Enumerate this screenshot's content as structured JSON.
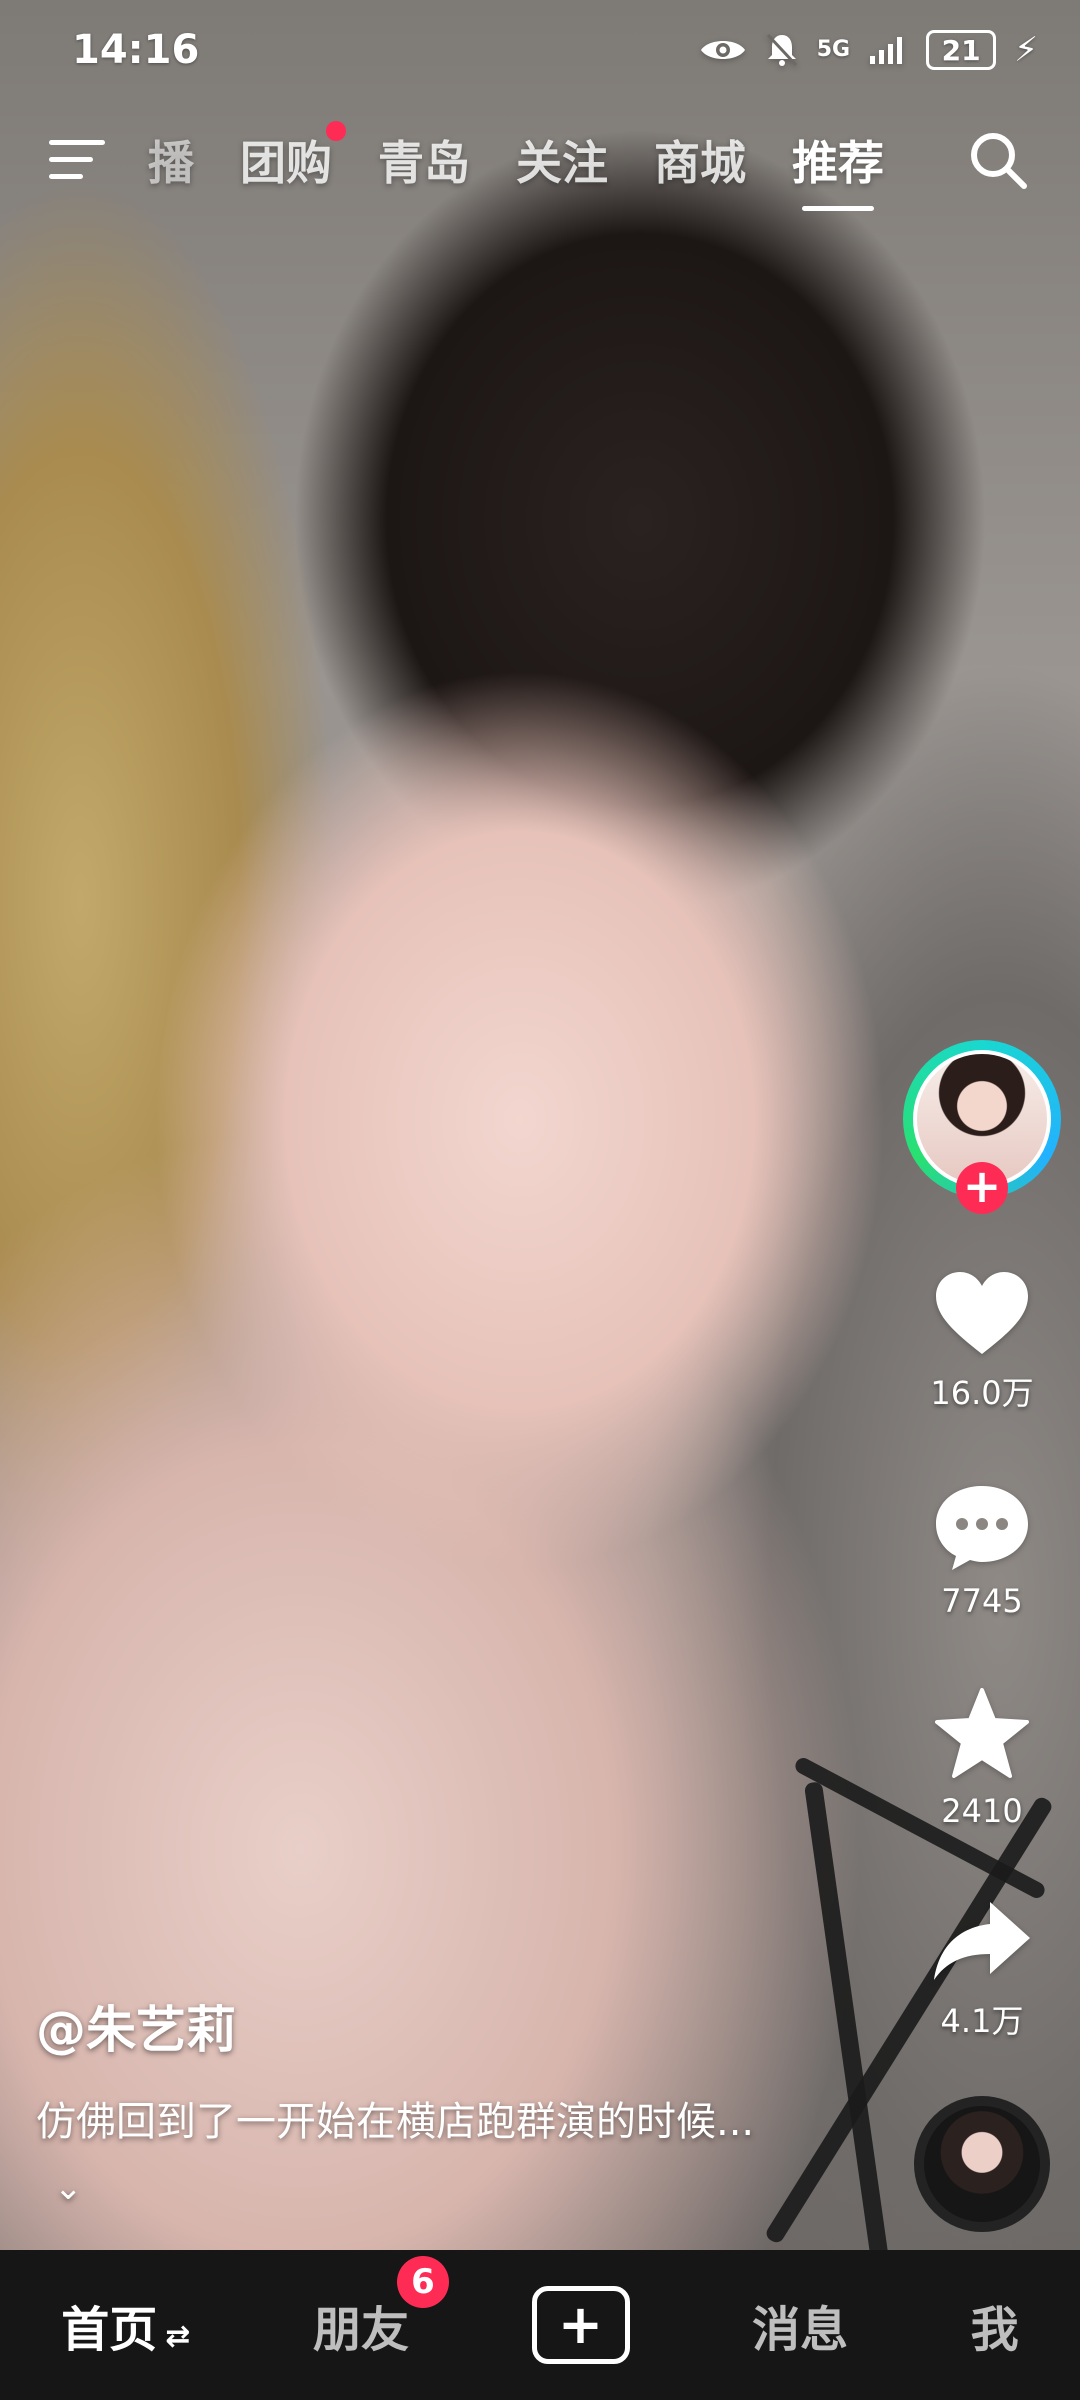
{
  "status_bar": {
    "time": "14:16",
    "network": "5G",
    "battery": "21",
    "icons": [
      "eye-icon",
      "bell-off-icon",
      "signal-icon",
      "battery-icon",
      "charging-icon"
    ]
  },
  "top_nav": {
    "tabs": [
      {
        "label": "播",
        "active": false
      },
      {
        "label": "团购",
        "active": false,
        "dot": true
      },
      {
        "label": "青岛",
        "active": false
      },
      {
        "label": "关注",
        "active": false
      },
      {
        "label": "商城",
        "active": false
      },
      {
        "label": "推荐",
        "active": true
      }
    ]
  },
  "actions": {
    "like_count": "16.0万",
    "comment_count": "7745",
    "favorite_count": "2410",
    "share_count": "4.1万",
    "follow_symbol": "+"
  },
  "caption": {
    "author": "@朱艺莉",
    "text": "仿佛回到了一开始在横店跑群演的时候...",
    "expand_symbol": "⌄"
  },
  "bottom_nav": {
    "items": [
      {
        "label": "首页",
        "active": true
      },
      {
        "label": "朋友",
        "badge": "6"
      },
      {
        "label": "+"
      },
      {
        "label": "消息"
      },
      {
        "label": "我"
      }
    ],
    "refresh_symbol": "⇄"
  },
  "colors": {
    "accent": "#fe2c55",
    "avatar_ring": "#19d8d0",
    "nav_background": "#161616"
  }
}
